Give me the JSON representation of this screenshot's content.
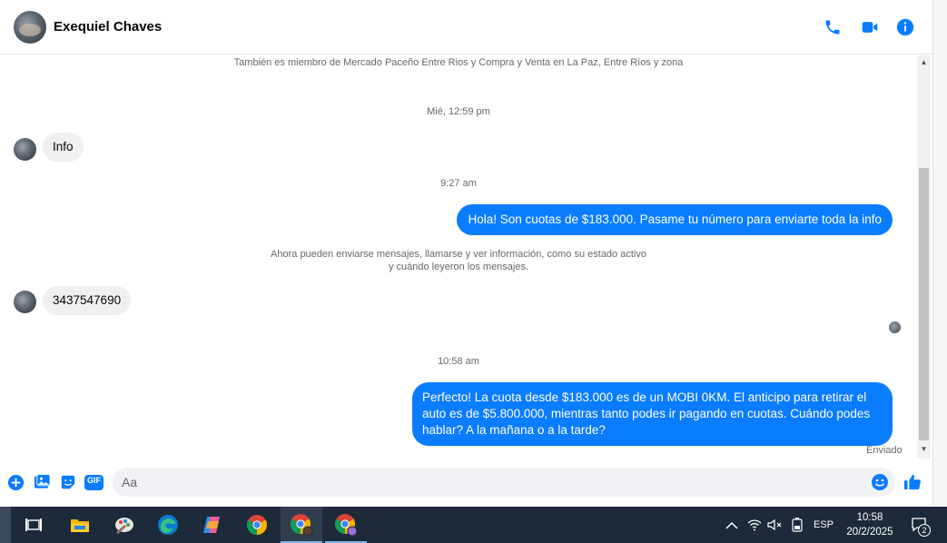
{
  "header": {
    "contact_name": "Exequiel Chaves",
    "icons": [
      "phone-icon",
      "video-camera-icon",
      "info-icon"
    ],
    "accent_color": "#0a7cff"
  },
  "chat": {
    "group_notice": "También es miembro de Mercado Paceño Entre Rios y Compra y Venta en La Paz, Entre Ríos y zona",
    "time_1": "Mié, 12:59 pm",
    "msg_in_1": "Info",
    "time_2": "9:27 am",
    "msg_out_1": "Hola! Son cuotas de $183.000. Pasame tu número para enviarte toda la info",
    "presence_notice_line1": "Ahora pueden enviarse mensajes, llamarse y ver información, como su estado activo",
    "presence_notice_line2": "y cuándo leyeron los mensajes.",
    "msg_in_2": "3437547690",
    "time_3": "10:58 am",
    "msg_out_2_line1": "Perfecto! La cuota desde $183.000 es de un MOBI 0KM. El anticipo para retirar el",
    "msg_out_2_line2": "auto es de $5.800.000, mientras tanto podes ir pagando en cuotas. Cuándo podes",
    "msg_out_2_line3": "hablar? A la mañana o a la tarde?",
    "status": "Enviado"
  },
  "composer": {
    "placeholder": "Aa",
    "gif_label": "GIF",
    "icons": [
      "plus-icon",
      "photo-icon",
      "sticker-icon",
      "gif-icon",
      "emoji-icon",
      "like-icon"
    ]
  },
  "taskbar": {
    "apps": [
      "task-view-icon",
      "file-explorer-icon",
      "paint-icon",
      "edge-icon",
      "copilot-icon",
      "chrome-icon",
      "chrome-profile-icon",
      "chrome-profile-2-icon"
    ],
    "language": "ESP",
    "time": "10:58",
    "date": "20/2/2025",
    "notification_count": "2"
  }
}
